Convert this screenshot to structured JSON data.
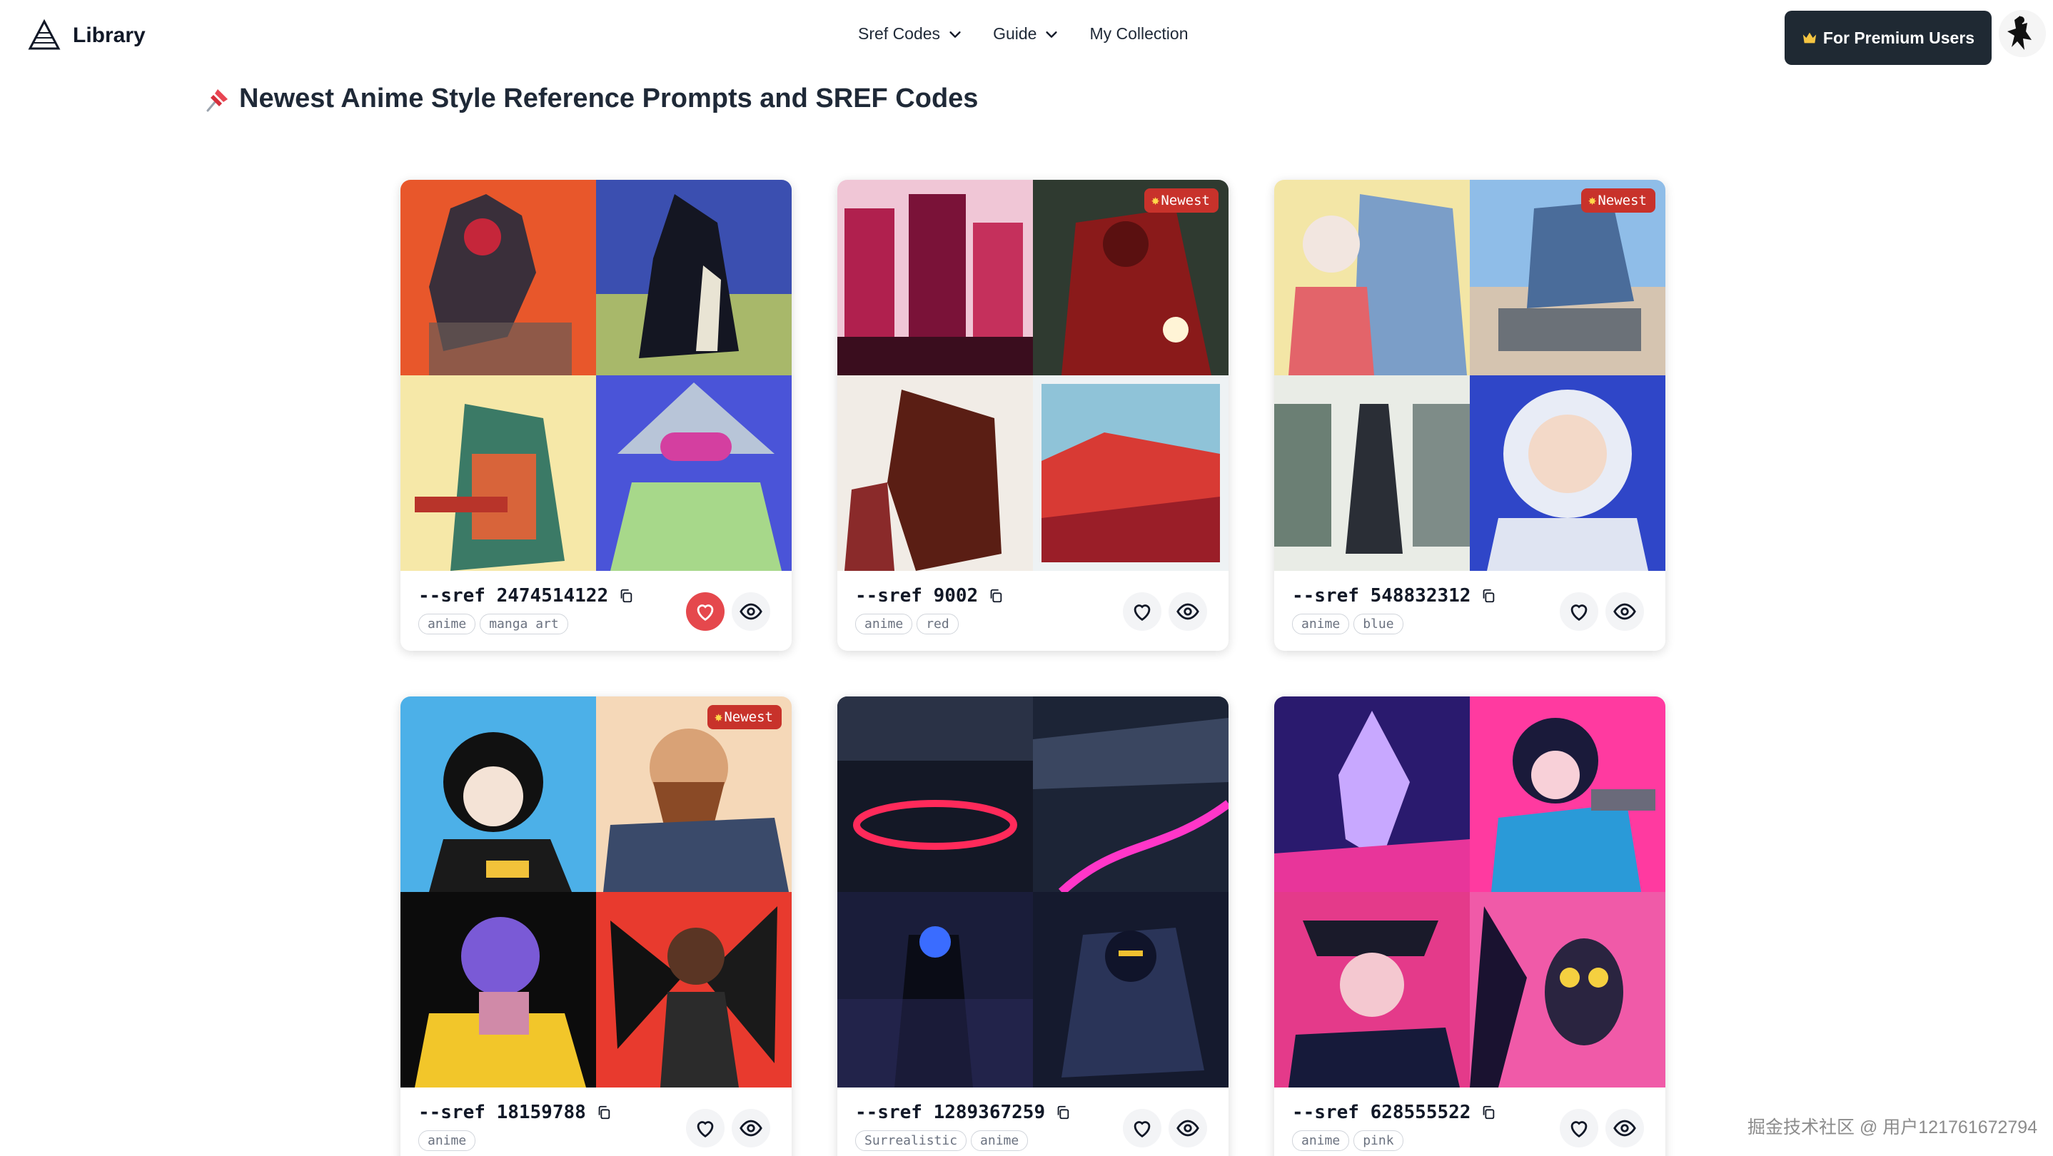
{
  "nav": {
    "brand": "Library",
    "menu": [
      {
        "label": "Sref Codes",
        "dropdown": true
      },
      {
        "label": "Guide",
        "dropdown": true
      },
      {
        "label": "My Collection",
        "dropdown": false
      }
    ],
    "premium_label": "For Premium Users"
  },
  "page": {
    "title": "Newest Anime Style Reference Prompts and SREF Codes"
  },
  "cards": [
    {
      "sref": "--sref 2474514122",
      "tags": [
        "anime",
        "manga art"
      ],
      "liked": true,
      "newest": false,
      "badge": ""
    },
    {
      "sref": "--sref 9002",
      "tags": [
        "anime",
        "red"
      ],
      "liked": false,
      "newest": true,
      "badge": "Newest"
    },
    {
      "sref": "--sref 548832312",
      "tags": [
        "anime",
        "blue"
      ],
      "liked": false,
      "newest": true,
      "badge": "Newest"
    },
    {
      "sref": "--sref 18159788",
      "tags": [
        "anime"
      ],
      "liked": false,
      "newest": true,
      "badge": "Newest"
    },
    {
      "sref": "--sref 1289367259",
      "tags": [
        "Surrealistic",
        "anime"
      ],
      "liked": false,
      "newest": false,
      "badge": ""
    },
    {
      "sref": "--sref 628555522",
      "tags": [
        "anime",
        "pink"
      ],
      "liked": false,
      "newest": false,
      "badge": ""
    }
  ],
  "watermark": "掘金技术社区 @ 用户121761672794",
  "colors": {
    "premium_button": "#1f2933",
    "liked": "#e5484d",
    "badge": "#c8322b"
  },
  "icons": {
    "brand": "pyramid-logo-icon",
    "title": "pushpin-icon",
    "copy": "copy-icon",
    "like": "heart-icon",
    "view": "eye-icon",
    "dropdown": "chevron-down-icon",
    "premium": "crown-icon"
  }
}
